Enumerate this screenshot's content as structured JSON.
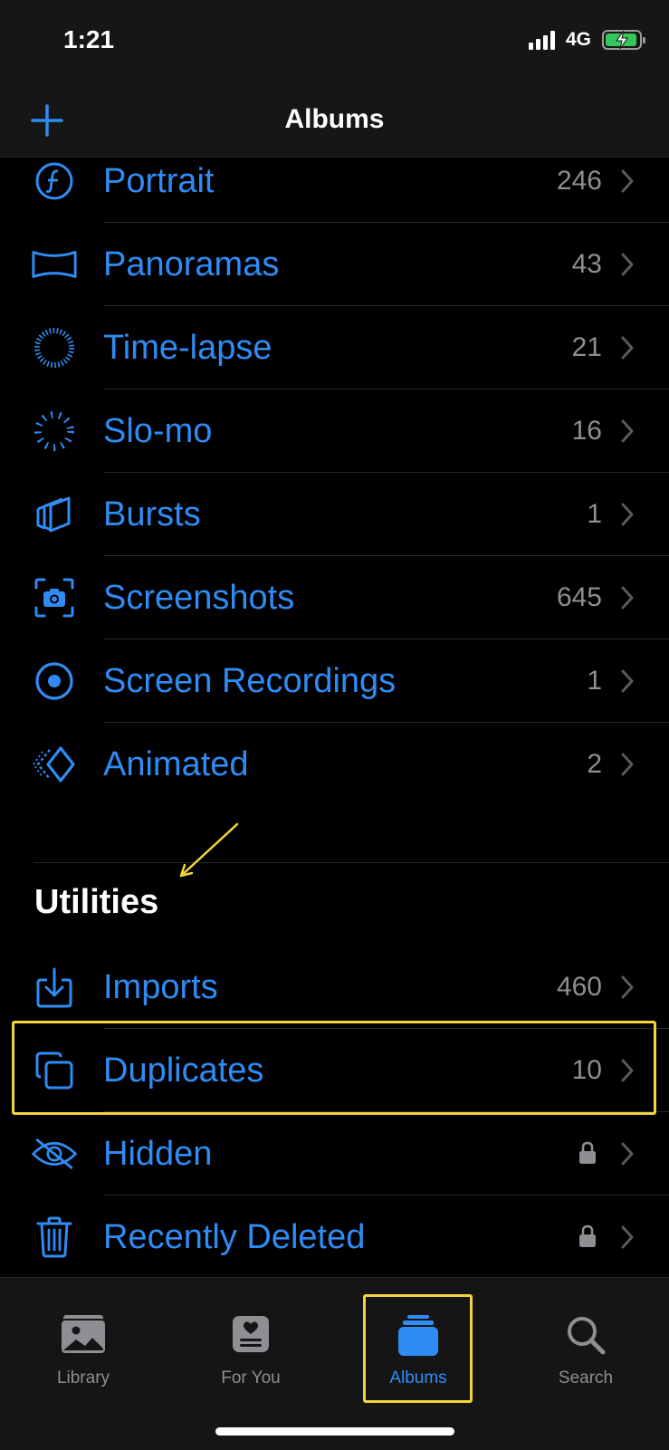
{
  "status": {
    "time": "1:21",
    "network": "4G"
  },
  "nav": {
    "title": "Albums"
  },
  "media_types": [
    {
      "label": "Portrait",
      "count": "246",
      "icon": "portrait-icon"
    },
    {
      "label": "Panoramas",
      "count": "43",
      "icon": "panorama-icon"
    },
    {
      "label": "Time-lapse",
      "count": "21",
      "icon": "timelapse-icon"
    },
    {
      "label": "Slo-mo",
      "count": "16",
      "icon": "slomo-icon"
    },
    {
      "label": "Bursts",
      "count": "1",
      "icon": "bursts-icon"
    },
    {
      "label": "Screenshots",
      "count": "645",
      "icon": "screenshot-icon"
    },
    {
      "label": "Screen Recordings",
      "count": "1",
      "icon": "screen-recording-icon"
    },
    {
      "label": "Animated",
      "count": "2",
      "icon": "animated-icon"
    }
  ],
  "utilities": {
    "title": "Utilities",
    "items": [
      {
        "label": "Imports",
        "count": "460",
        "icon": "import-icon"
      },
      {
        "label": "Duplicates",
        "count": "10",
        "icon": "duplicates-icon"
      },
      {
        "label": "Hidden",
        "count": "",
        "icon": "hidden-eye-icon",
        "locked": true
      },
      {
        "label": "Recently Deleted",
        "count": "",
        "icon": "trash-icon",
        "locked": true
      }
    ]
  },
  "tabs": [
    {
      "label": "Library",
      "icon": "photo-library-icon"
    },
    {
      "label": "For You",
      "icon": "for-you-icon"
    },
    {
      "label": "Albums",
      "icon": "albums-icon",
      "active": true
    },
    {
      "label": "Search",
      "icon": "search-icon"
    }
  ],
  "colors": {
    "accent": "#2f8cf4",
    "highlight": "#f3d43a",
    "battery": "#34c759"
  }
}
